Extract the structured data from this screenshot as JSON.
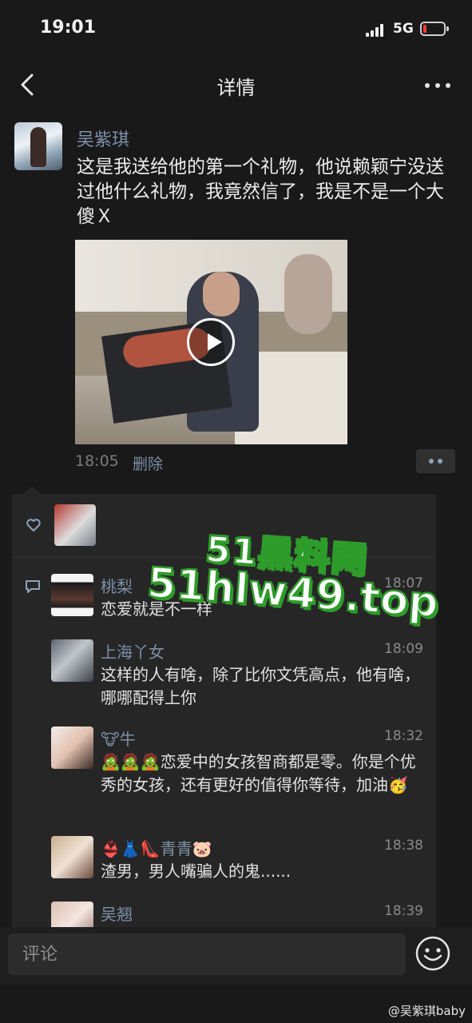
{
  "status_bar": {
    "time": "19:01",
    "network": "5G",
    "battery_level": 0.12,
    "battery_color": "#ff3b30"
  },
  "nav": {
    "title": "详情",
    "back_icon": "chevron-left-icon",
    "more_icon": "more-icon"
  },
  "post": {
    "author": "吴紫琪",
    "text": "这是我送给他的第一个礼物，他说赖颖宁没送过他什么礼物，我竟然信了，我是不是一个大傻Ｘ",
    "video_icon": "play-icon",
    "time": "18:05",
    "delete_label": "删除"
  },
  "likes": {
    "icon": "heart-icon"
  },
  "comments_icon": "comment-icon",
  "comments": [
    {
      "name": "桃梨",
      "time": "18:07",
      "text": "恋爱就是不一样"
    },
    {
      "name": "上海丫女",
      "time": "18:09",
      "text": "这样的人有啥，除了比你文凭高点，他有啥，哪哪配得上你"
    },
    {
      "name": "🐮牛",
      "time": "18:32",
      "text": "🧟🧟🧟恋爱中的女孩智商都是零。你是个优秀的女孩，还有更好的值得你等待，加油🥳"
    },
    {
      "name": "👙👗👠青青🐷",
      "time": "18:38",
      "text": "渣男，男人嘴骗人的鬼......"
    },
    {
      "name": "吴翘",
      "time": "18:39",
      "text": ""
    }
  ],
  "watermark": {
    "line1": "51黑料网",
    "line2": "51hlw49.top",
    "color": "#2e9c2a"
  },
  "input": {
    "placeholder": "评论",
    "emoji_icon": "emoji-icon"
  },
  "credit": "@吴紫琪baby"
}
